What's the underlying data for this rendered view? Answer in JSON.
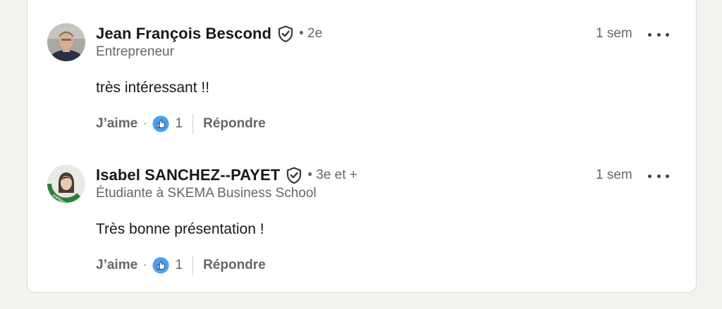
{
  "colors": {
    "background": "#f4f2ee",
    "card": "#ffffff",
    "text_primary": "#191919",
    "text_secondary": "#666666",
    "like_blue": "#378fe9",
    "badge_green": "#2e7d3a"
  },
  "comments": [
    {
      "author": "Jean François Bescond",
      "verified_icon": "shield-check-icon",
      "degree": "• 2e",
      "headline": "Entrepreneur",
      "time": "1 sem",
      "menu_icon": "more-horizontal-icon",
      "text": "très intéressant !!",
      "like_label": "J’aime",
      "separator": "·",
      "reaction_icon": "like-reaction-icon",
      "reaction_count": "1",
      "reply_label": "Répondre"
    },
    {
      "author": "Isabel SANCHEZ--PAYET",
      "verified_icon": "shield-check-icon",
      "degree": "• 3e et +",
      "headline": "Étudiante à SKEMA Business School",
      "time": "1 sem",
      "menu_icon": "more-horizontal-icon",
      "text": "Très bonne présentation !",
      "like_label": "J’aime",
      "separator": "·",
      "reaction_icon": "like-reaction-icon",
      "reaction_count": "1",
      "reply_label": "Répondre",
      "avatar_badge": "#OPENTOWORK"
    }
  ]
}
